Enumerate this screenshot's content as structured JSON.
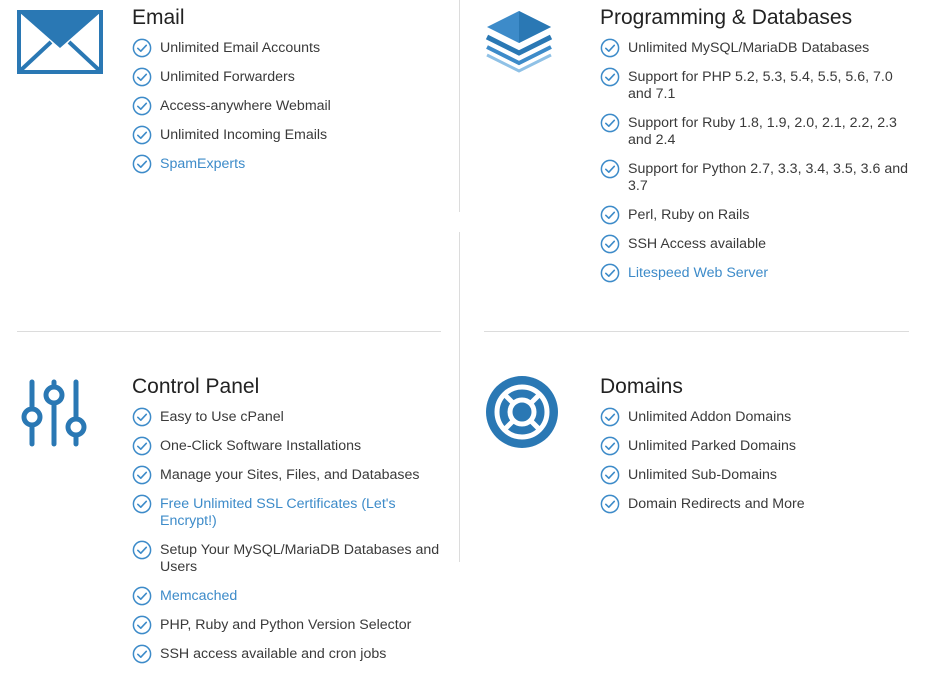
{
  "colors": {
    "accent": "#3d8bc9",
    "icon_blue": "#2a78b4",
    "check": "#3d8bc9",
    "divider": "#dcdcdc"
  },
  "sections": [
    {
      "id": "email",
      "icon": "envelope-icon",
      "title": "Email",
      "items": [
        {
          "text": "Unlimited Email Accounts",
          "link": false
        },
        {
          "text": "Unlimited Forwarders",
          "link": false
        },
        {
          "text": "Access-anywhere Webmail",
          "link": false
        },
        {
          "text": "Unlimited Incoming Emails",
          "link": false
        },
        {
          "text": "SpamExperts",
          "link": true
        }
      ]
    },
    {
      "id": "programming",
      "icon": "database-layers-icon",
      "title": "Programming & Databases",
      "items": [
        {
          "text": "Unlimited MySQL/MariaDB Databases",
          "link": false
        },
        {
          "text": "Support for PHP 5.2, 5.3, 5.4, 5.5, 5.6, 7.0 and 7.1",
          "link": false
        },
        {
          "text": "Support for Ruby 1.8, 1.9, 2.0, 2.1, 2.2, 2.3 and 2.4",
          "link": false
        },
        {
          "text": "Support for Python 2.7, 3.3, 3.4, 3.5, 3.6 and 3.7",
          "link": false
        },
        {
          "text": "Perl, Ruby on Rails",
          "link": false
        },
        {
          "text": "SSH Access available",
          "link": false
        },
        {
          "text": "Litespeed Web Server",
          "link": true
        }
      ]
    },
    {
      "id": "control-panel",
      "icon": "sliders-icon",
      "title": "Control Panel",
      "items": [
        {
          "text": "Easy to Use cPanel",
          "link": false
        },
        {
          "text": "One-Click Software Installations",
          "link": false
        },
        {
          "text": "Manage your Sites, Files, and Databases",
          "link": false
        },
        {
          "text": "Free Unlimited SSL Certificates (Let's Encrypt!)",
          "link": true
        },
        {
          "text": "Setup Your MySQL/MariaDB Databases and Users",
          "link": false
        },
        {
          "text": "Memcached",
          "link": true
        },
        {
          "text": "PHP, Ruby and Python Version Selector",
          "link": false
        },
        {
          "text": "SSH access available and cron jobs",
          "link": false
        }
      ]
    },
    {
      "id": "domains",
      "icon": "lifebuoy-icon",
      "title": "Domains",
      "items": [
        {
          "text": "Unlimited Addon Domains",
          "link": false
        },
        {
          "text": "Unlimited Parked Domains",
          "link": false
        },
        {
          "text": "Unlimited Sub-Domains",
          "link": false
        },
        {
          "text": "Domain Redirects and More",
          "link": false
        }
      ]
    }
  ]
}
